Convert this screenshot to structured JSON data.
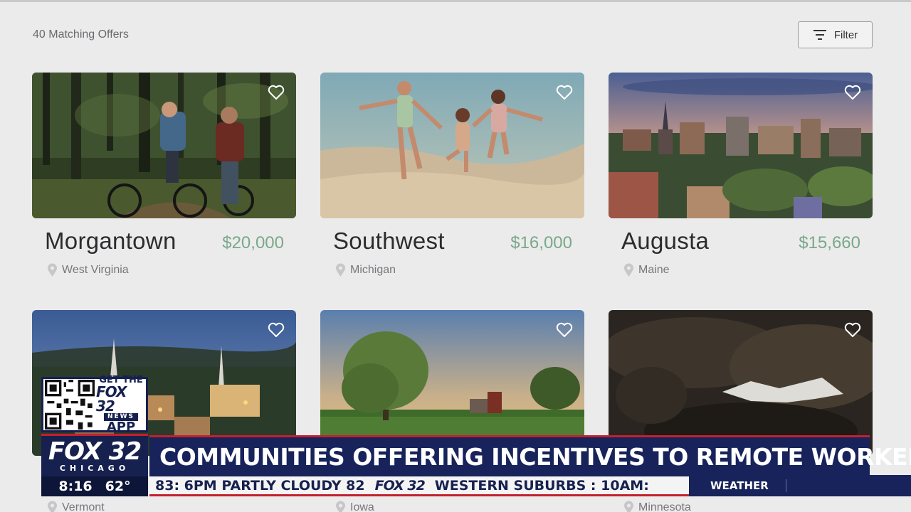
{
  "header": {
    "count_label": "40 Matching Offers",
    "filter_label": "Filter"
  },
  "offers": [
    {
      "title": "Morgantown",
      "price": "$20,000",
      "location": "West Virginia"
    },
    {
      "title": "Southwest",
      "price": "$16,000",
      "location": "Michigan"
    },
    {
      "title": "Augusta",
      "price": "$15,660",
      "location": "Maine"
    },
    {
      "title": "",
      "price": "",
      "location": "Vermont"
    },
    {
      "title": "",
      "price": "",
      "location": "Iowa"
    },
    {
      "title": "",
      "price": "",
      "location": "Minnesota"
    }
  ],
  "icons": {
    "favorite": "heart-outline-icon",
    "location": "map-pin-icon",
    "filter": "filter-lines-icon"
  },
  "colors": {
    "price_green": "#7aa889",
    "broadcast_navy": "#17235a",
    "broadcast_red": "#c4202e"
  },
  "broadcast": {
    "qr_get": "GET THE",
    "qr_fox": "FOX 32",
    "qr_news": "NEWS",
    "qr_app": "APP",
    "logo_fox": "FOX 32",
    "logo_city": "CHICAGO",
    "headline": "COMMUNITIES OFFERING INCENTIVES TO REMOTE WORKERS",
    "time": "8:16",
    "temp": "62°",
    "ticker_left": "83:  6PM  PARTLY  CLOUDY  82",
    "ticker_logo": "FOX 32",
    "ticker_right": "WESTERN  SUBURBS  :  10AM:",
    "weather_label": "WEATHER"
  }
}
